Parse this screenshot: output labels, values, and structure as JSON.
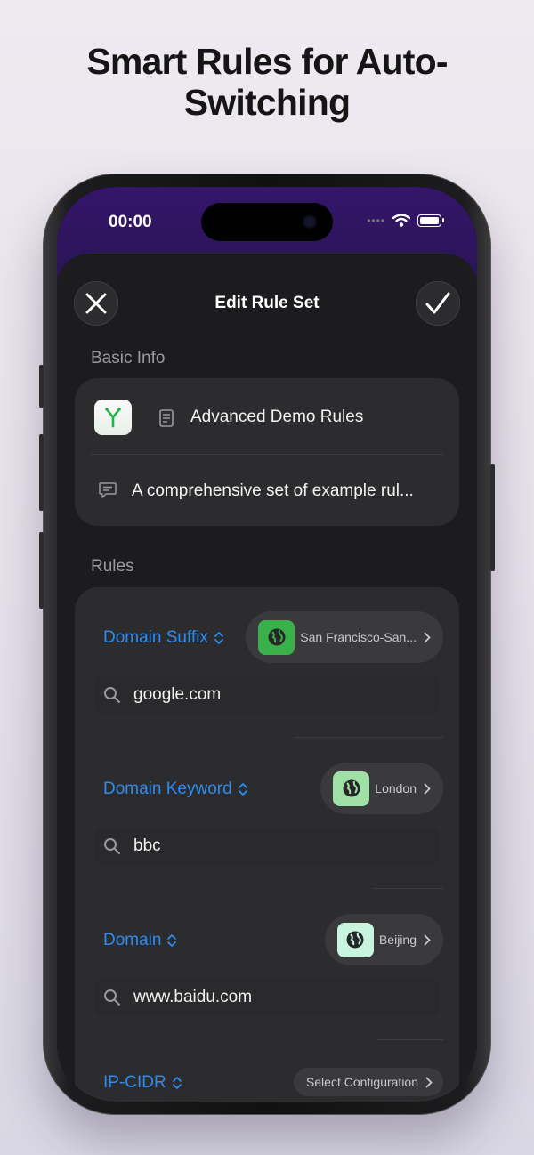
{
  "headline": {
    "line1": "Smart Rules for Auto-",
    "line2": "Switching"
  },
  "status_bar": {
    "time": "00:00",
    "icons": [
      "cellular-dots-icon",
      "wifi-icon",
      "battery-icon"
    ]
  },
  "nav": {
    "title": "Edit Rule Set",
    "close_icon": "close-icon",
    "confirm_icon": "checkmark-icon"
  },
  "basic_info": {
    "section_title": "Basic Info",
    "name": "Advanced Demo Rules",
    "description": "A comprehensive set of example rul..."
  },
  "rules": {
    "section_title": "Rules",
    "items": [
      {
        "type": "Domain Suffix",
        "value": "google.com",
        "config": "San Francisco-San...",
        "icon_color": "#3ab04a"
      },
      {
        "type": "Domain Keyword",
        "value": "bbc",
        "config": "London",
        "icon_color": "#9ee0a6"
      },
      {
        "type": "Domain",
        "value": "www.baidu.com",
        "config": "Beijing",
        "icon_color": "#c9f5de"
      },
      {
        "type": "IP-CIDR",
        "value": "",
        "config": "Select Configuration",
        "icon_color": ""
      }
    ]
  },
  "colors": {
    "accent": "#2d8cf0",
    "sheet": "#1c1c1e",
    "card": "#2c2c2e",
    "wallpaper": "#2a1556"
  }
}
